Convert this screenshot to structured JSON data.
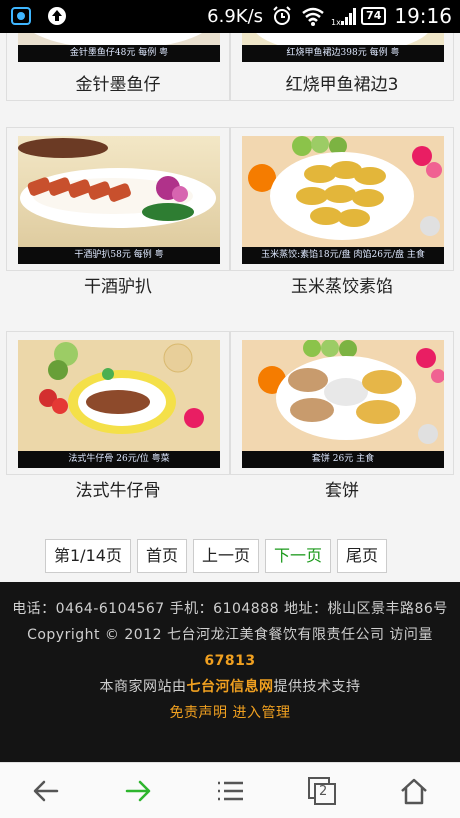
{
  "status": {
    "speed": "6.9K/s",
    "battery": "74",
    "time": "19:16"
  },
  "dishes": [
    {
      "name": "金针墨鱼仔",
      "caption": "金针墨鱼仔48元    每例  粤"
    },
    {
      "name": "红烧甲鱼裙边3",
      "caption": "红烧甲鱼裙边398元    每例  粤"
    },
    {
      "name": "干酒驴扒",
      "caption": "干酒驴扒58元    每例  粤"
    },
    {
      "name": "玉米蒸饺素馅",
      "caption": "玉米蒸饺:素馅18元/盘  肉馅26元/盘  主食"
    },
    {
      "name": "法式牛仔骨",
      "caption": "法式牛仔骨  26元/位  粤菜"
    },
    {
      "name": "套饼",
      "caption": "套饼  26元  主食"
    }
  ],
  "pager": {
    "current": "第1/14页",
    "first": "首页",
    "prev": "上一页",
    "next": "下一页",
    "last": "尾页"
  },
  "footer": {
    "line1": "电话：0464-6104567 手机：6104888 地址：桃山区景丰路86号",
    "copyright": "Copyright © 2012 七台河龙江美食餐饮有限责任公司 访问量",
    "visits": "67813",
    "support_prefix": "本商家网站由",
    "support_link": "七台河信息网",
    "support_suffix": "提供技术支持",
    "disclaimer": "免责声明",
    "admin": "进入管理"
  },
  "navbar": {
    "tabs_count": "2"
  },
  "colors": {
    "accent_green": "#1c9a1c",
    "footer_orange": "#f0a020"
  }
}
